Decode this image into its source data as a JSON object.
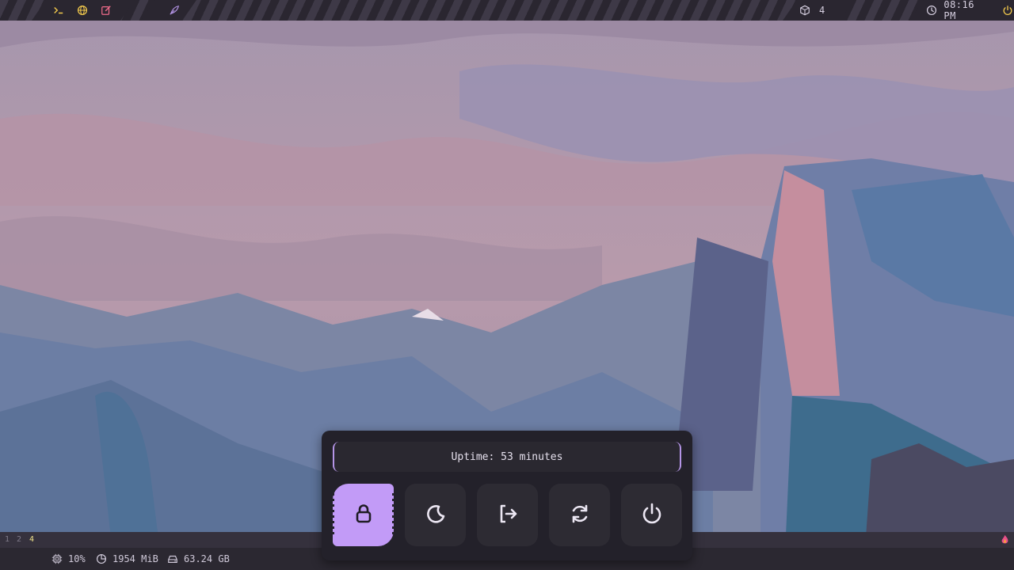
{
  "topbar": {
    "left_icons": [
      "terminal-icon",
      "globe-icon",
      "edit-icon",
      "feather-icon"
    ],
    "package_count": "4",
    "clock": "08:16 PM"
  },
  "workspaces": [
    "1",
    "2",
    "4"
  ],
  "status": {
    "cpu": "10%",
    "memory": "1954 MiB",
    "disk": "63.24 GB"
  },
  "power_menu": {
    "uptime": "Uptime: 53 minutes",
    "buttons": [
      {
        "icon": "lock-icon",
        "active": true
      },
      {
        "icon": "moon-icon",
        "active": false
      },
      {
        "icon": "logout-icon",
        "active": false
      },
      {
        "icon": "reboot-icon",
        "active": false
      },
      {
        "icon": "power-icon",
        "active": false
      }
    ]
  },
  "colors": {
    "accent": "#c29bf7",
    "bar_bg": "#2f2b36",
    "panel_bg": "#23212a"
  }
}
